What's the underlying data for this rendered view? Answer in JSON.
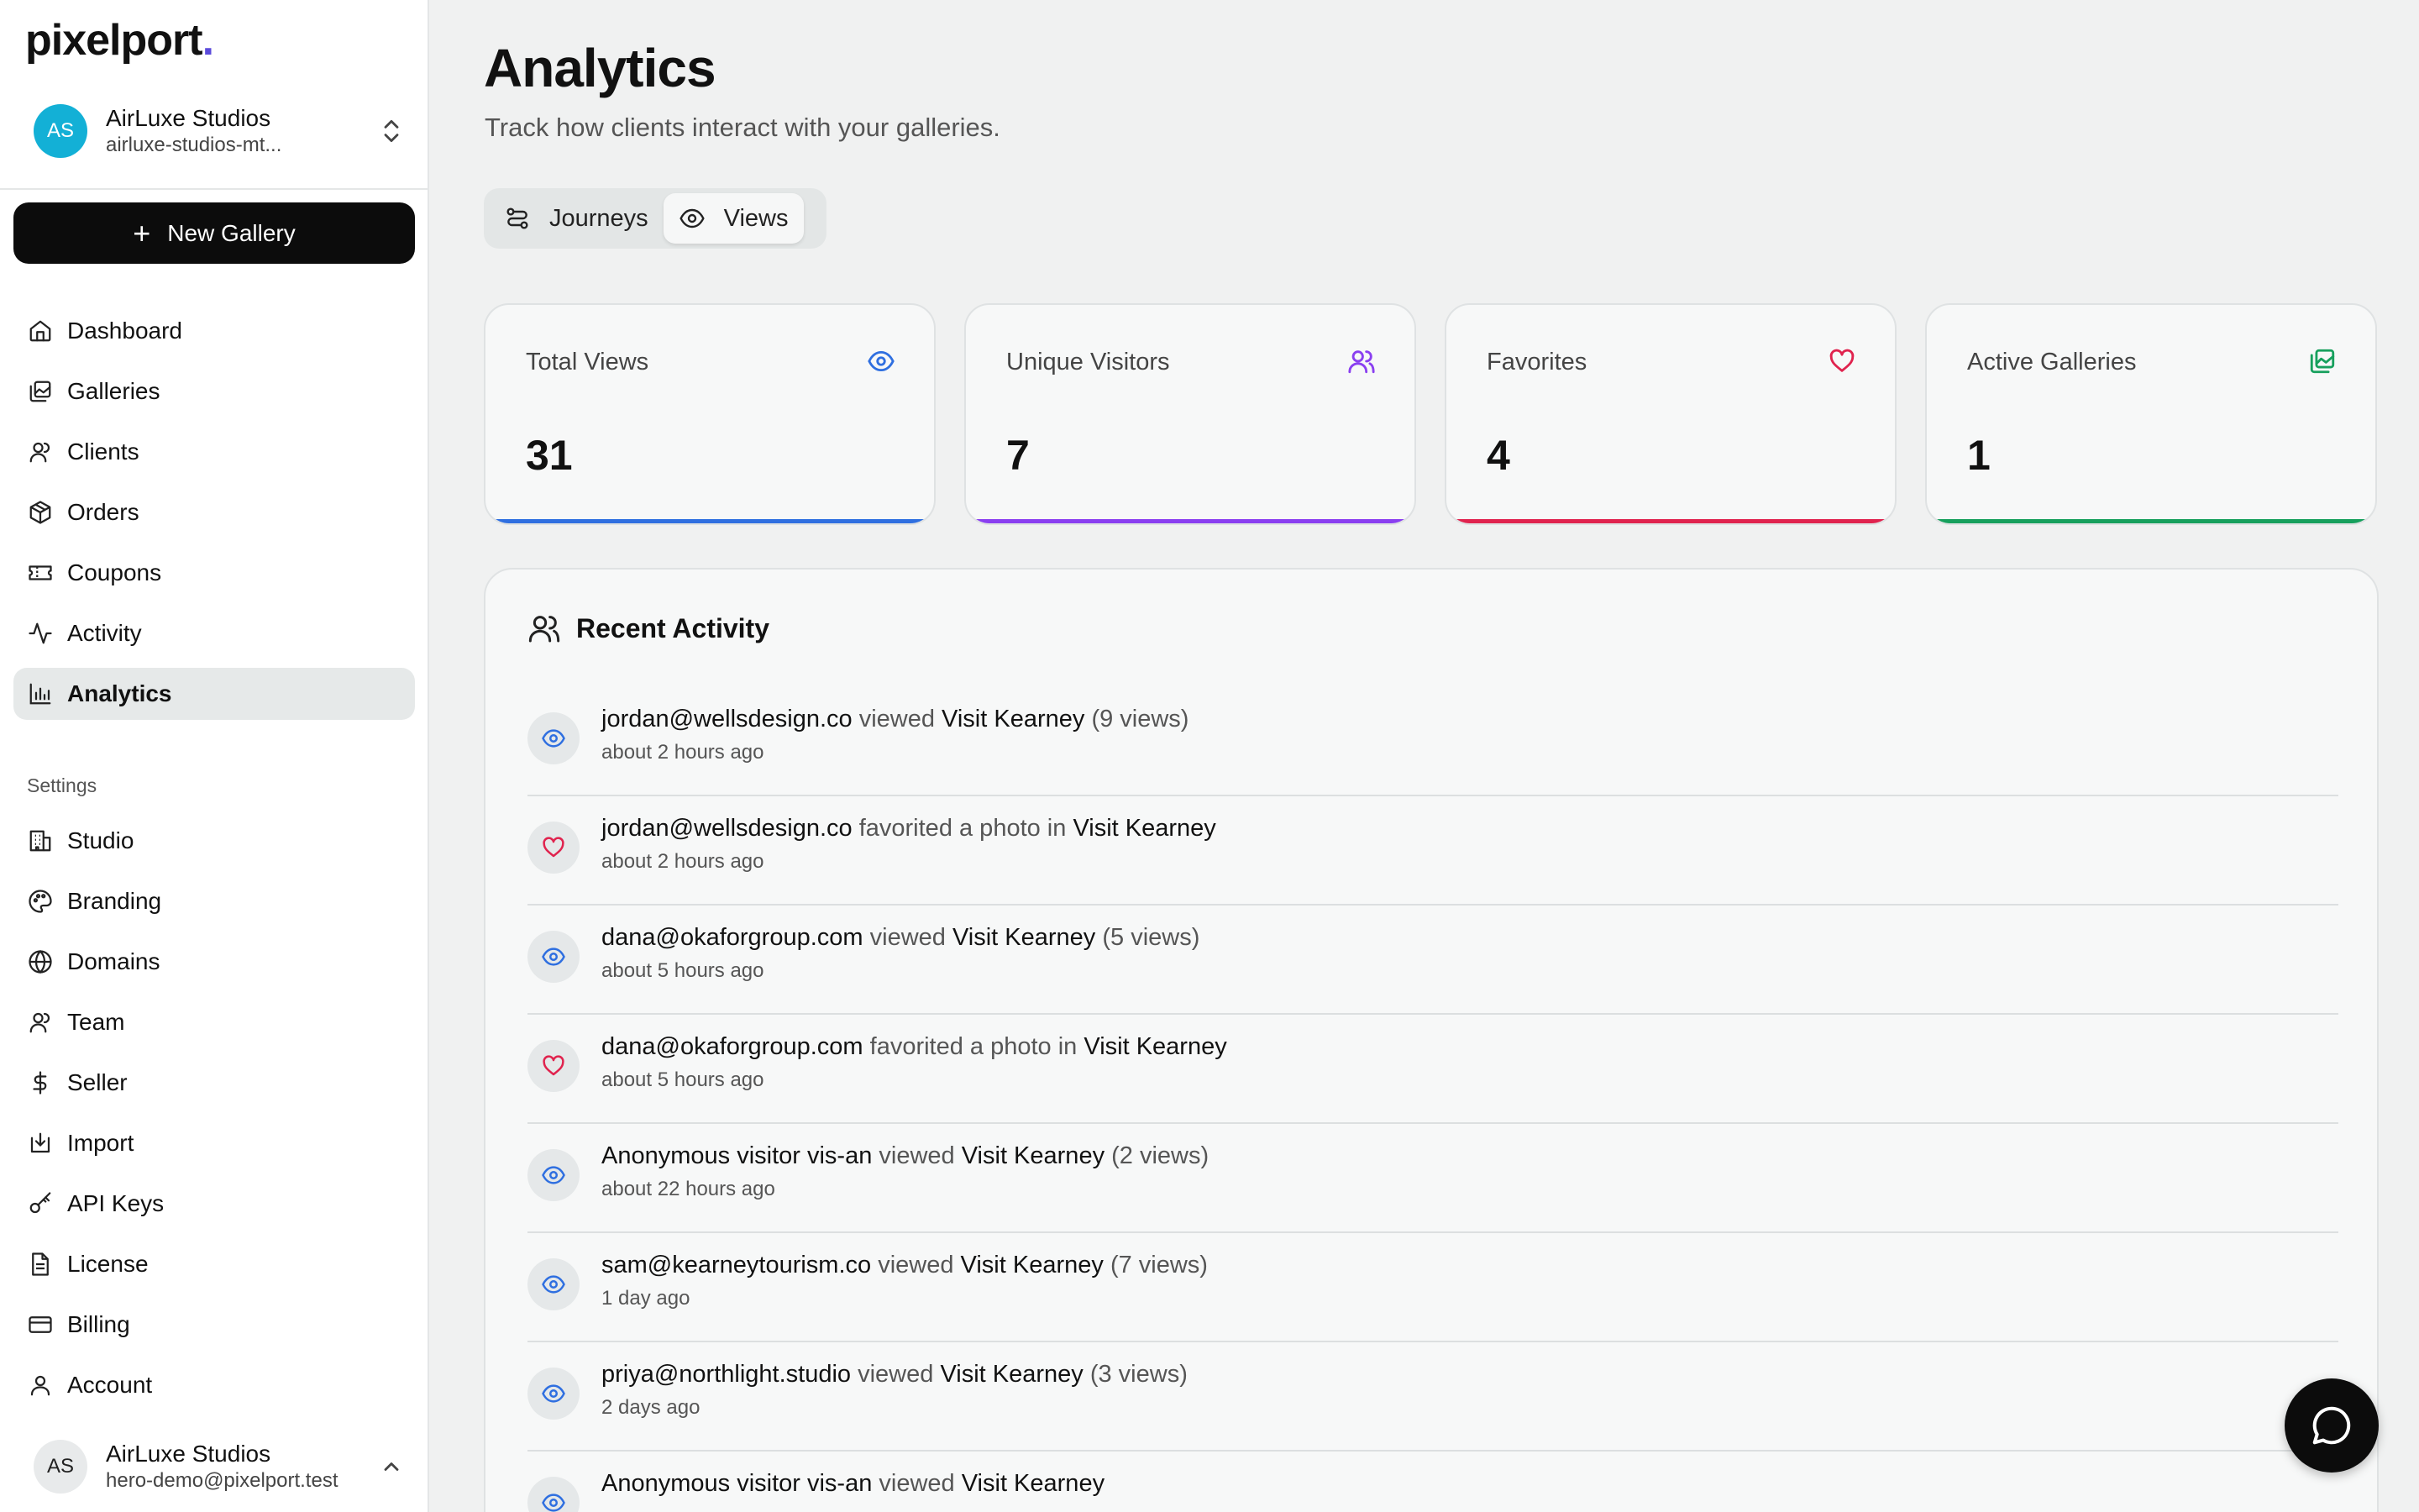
{
  "brand": {
    "name": "pixelport",
    "dot": ".",
    "accent": "#5b4bdb"
  },
  "studio": {
    "initials": "AS",
    "name": "AirLuxe Studios",
    "slug": "airluxe-studios-mt..."
  },
  "new_gallery_label": "New Gallery",
  "nav": {
    "main": [
      {
        "label": "Dashboard",
        "icon": "home-icon"
      },
      {
        "label": "Galleries",
        "icon": "gallery-icon"
      },
      {
        "label": "Clients",
        "icon": "user-icon"
      },
      {
        "label": "Orders",
        "icon": "package-icon"
      },
      {
        "label": "Coupons",
        "icon": "ticket-icon"
      },
      {
        "label": "Activity",
        "icon": "activity-icon"
      },
      {
        "label": "Analytics",
        "icon": "bar-chart-icon",
        "active": true
      }
    ],
    "settings_label": "Settings",
    "settings": [
      {
        "label": "Studio",
        "icon": "building-icon"
      },
      {
        "label": "Branding",
        "icon": "palette-icon"
      },
      {
        "label": "Domains",
        "icon": "globe-icon"
      },
      {
        "label": "Team",
        "icon": "team-icon"
      },
      {
        "label": "Seller",
        "icon": "dollar-icon"
      },
      {
        "label": "Import",
        "icon": "import-icon"
      },
      {
        "label": "API Keys",
        "icon": "key-icon"
      },
      {
        "label": "License",
        "icon": "file-icon"
      },
      {
        "label": "Billing",
        "icon": "credit-card-icon"
      },
      {
        "label": "Account",
        "icon": "user-icon"
      }
    ]
  },
  "account": {
    "initials": "AS",
    "name": "AirLuxe Studios",
    "email": "hero-demo@pixelport.test"
  },
  "page": {
    "title": "Analytics",
    "subtitle": "Track how clients interact with your galleries."
  },
  "toggle": {
    "journeys_label": "Journeys",
    "views_label": "Views",
    "active": "Views"
  },
  "stats": [
    {
      "label": "Total Views",
      "value": "31",
      "icon": "eye-icon",
      "color": "#2f6fe0"
    },
    {
      "label": "Unique Visitors",
      "value": "7",
      "icon": "users-icon",
      "color": "#8a3ff0"
    },
    {
      "label": "Favorites",
      "value": "4",
      "icon": "heart-icon",
      "color": "#e0234e"
    },
    {
      "label": "Active Galleries",
      "value": "1",
      "icon": "gallery-icon",
      "color": "#17a05d"
    }
  ],
  "activity": {
    "title": "Recent Activity",
    "items": [
      {
        "type": "view",
        "actor": "jordan@wellsdesign.co",
        "verb": " viewed ",
        "target": "Visit Kearney",
        "extra": " (9 views)",
        "time": "about 2 hours ago"
      },
      {
        "type": "favorite",
        "actor": "jordan@wellsdesign.co",
        "verb": " favorited a photo in ",
        "target": "Visit Kearney",
        "extra": "",
        "time": "about 2 hours ago"
      },
      {
        "type": "view",
        "actor": "dana@okaforgroup.com",
        "verb": " viewed ",
        "target": "Visit Kearney",
        "extra": " (5 views)",
        "time": "about 5 hours ago"
      },
      {
        "type": "favorite",
        "actor": "dana@okaforgroup.com",
        "verb": " favorited a photo in ",
        "target": "Visit Kearney",
        "extra": "",
        "time": "about 5 hours ago"
      },
      {
        "type": "view",
        "actor": "Anonymous visitor vis-an",
        "verb": " viewed ",
        "target": "Visit Kearney",
        "extra": " (2 views)",
        "time": "about 22 hours ago"
      },
      {
        "type": "view",
        "actor": "sam@kearneytourism.co",
        "verb": " viewed ",
        "target": "Visit Kearney",
        "extra": " (7 views)",
        "time": "1 day ago"
      },
      {
        "type": "view",
        "actor": "priya@northlight.studio",
        "verb": " viewed ",
        "target": "Visit Kearney",
        "extra": " (3 views)",
        "time": "2 days ago"
      },
      {
        "type": "view",
        "actor": "Anonymous visitor vis-an",
        "verb": " viewed ",
        "target": "Visit Kearney",
        "extra": "",
        "time": ""
      }
    ]
  },
  "colors": {
    "view_icon": "#2f6fe0",
    "favorite_icon": "#e0234e",
    "chat_button": "#0c0c0c"
  }
}
